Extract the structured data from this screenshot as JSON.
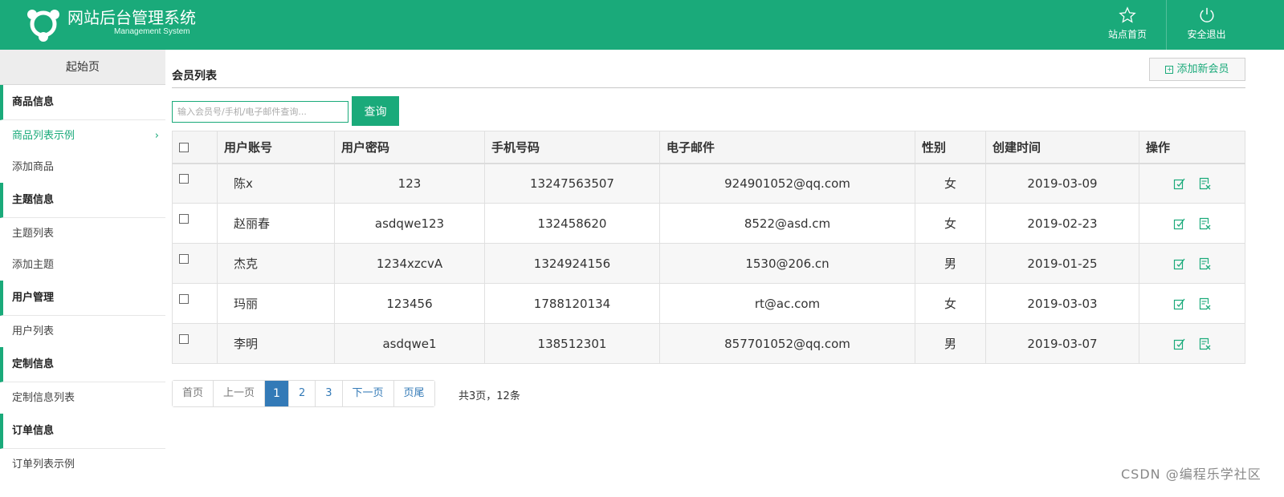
{
  "header": {
    "title": "网站后台管理系统",
    "subtitle": "Management System",
    "actions": [
      {
        "label": "站点首页",
        "icon": "star-icon"
      },
      {
        "label": "安全退出",
        "icon": "power-icon"
      }
    ],
    "bg_color": "#1aaa7a"
  },
  "sidebar": {
    "start_label": "起始页",
    "groups": [
      {
        "title": "商品信息",
        "items": [
          "商品列表示例",
          "添加商品"
        ]
      },
      {
        "title": "主题信息",
        "items": [
          "主题列表",
          "添加主题"
        ]
      },
      {
        "title": "用户管理",
        "items": [
          "用户列表"
        ]
      },
      {
        "title": "定制信息",
        "items": [
          "定制信息列表"
        ]
      },
      {
        "title": "订单信息",
        "items": [
          "订单列表示例"
        ]
      }
    ],
    "active_item": "商品列表示例",
    "chevron": "›"
  },
  "main": {
    "title": "会员列表",
    "add_button": "添加新会员",
    "add_plus": "+",
    "search": {
      "placeholder": "输入会员号/手机/电子邮件查询...",
      "button": "查询"
    },
    "columns": [
      "用户账号",
      "用户密码",
      "手机号码",
      "电子邮件",
      "性别",
      "创建时间",
      "操作"
    ],
    "rows": [
      {
        "account": "陈x",
        "password": "123",
        "phone": "13247563507",
        "email": "924901052@qq.com",
        "gender": "女",
        "created": "2019-03-09"
      },
      {
        "account": "赵丽春",
        "password": "asdqwe123",
        "phone": "132458620",
        "email": "8522@asd.cm",
        "gender": "女",
        "created": "2019-02-23"
      },
      {
        "account": "杰克",
        "password": "1234xzcvA",
        "phone": "1324924156",
        "email": "1530@206.cn",
        "gender": "男",
        "created": "2019-01-25"
      },
      {
        "account": "玛丽",
        "password": "123456",
        "phone": "1788120134",
        "email": "rt@ac.com",
        "gender": "女",
        "created": "2019-03-03"
      },
      {
        "account": "李明",
        "password": "asdqwe1",
        "phone": "138512301",
        "email": "857701052@qq.com",
        "gender": "男",
        "created": "2019-03-07"
      }
    ],
    "row_actions": [
      "edit-icon",
      "delete-icon"
    ]
  },
  "pagination": {
    "first": "首页",
    "prev": "上一页",
    "pages": [
      "1",
      "2",
      "3"
    ],
    "current": "1",
    "next": "下一页",
    "last": "页尾",
    "info": "共3页，12条"
  },
  "watermark": "CSDN @编程乐学社区",
  "accent_color": "#1aaa7a"
}
